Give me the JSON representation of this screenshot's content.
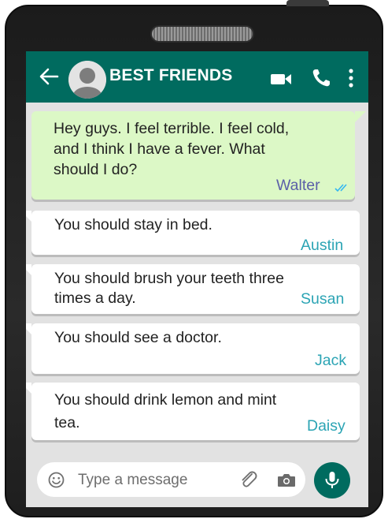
{
  "header": {
    "title": "BEST FRIENDS",
    "back_icon": "back-arrow-icon",
    "avatar_icon": "avatar-icon",
    "video_icon": "video-call-icon",
    "call_icon": "phone-call-icon",
    "menu_icon": "more-vertical-icon"
  },
  "messages": [
    {
      "text": "Hey guys. I feel terrible. I feel cold,\nand I think I have a fever. What\nshould I do?",
      "sender": "Walter",
      "direction": "outgoing",
      "status_icon": "double-check-icon"
    },
    {
      "text": "You should stay in bed.",
      "sender": "Austin",
      "direction": "incoming"
    },
    {
      "text": "You should brush your teeth three\ntimes a day.",
      "sender": "Susan",
      "direction": "incoming"
    },
    {
      "text": "You should see a doctor.",
      "sender": "Jack",
      "direction": "incoming"
    },
    {
      "text": "You should drink lemon and mint\ntea.",
      "sender": "Daisy",
      "direction": "incoming"
    }
  ],
  "composer": {
    "placeholder": "Type a message",
    "emoji_icon": "emoji-icon",
    "attach_icon": "paperclip-icon",
    "camera_icon": "camera-icon",
    "mic_icon": "microphone-icon"
  },
  "colors": {
    "header": "#006b5f",
    "outgoing_bubble": "#dcf8c6",
    "incoming_bubble": "#ffffff",
    "sender_incoming": "#2ba4b4",
    "sender_outgoing": "#5b5fa8",
    "chat_background": "#e2e2e2"
  }
}
